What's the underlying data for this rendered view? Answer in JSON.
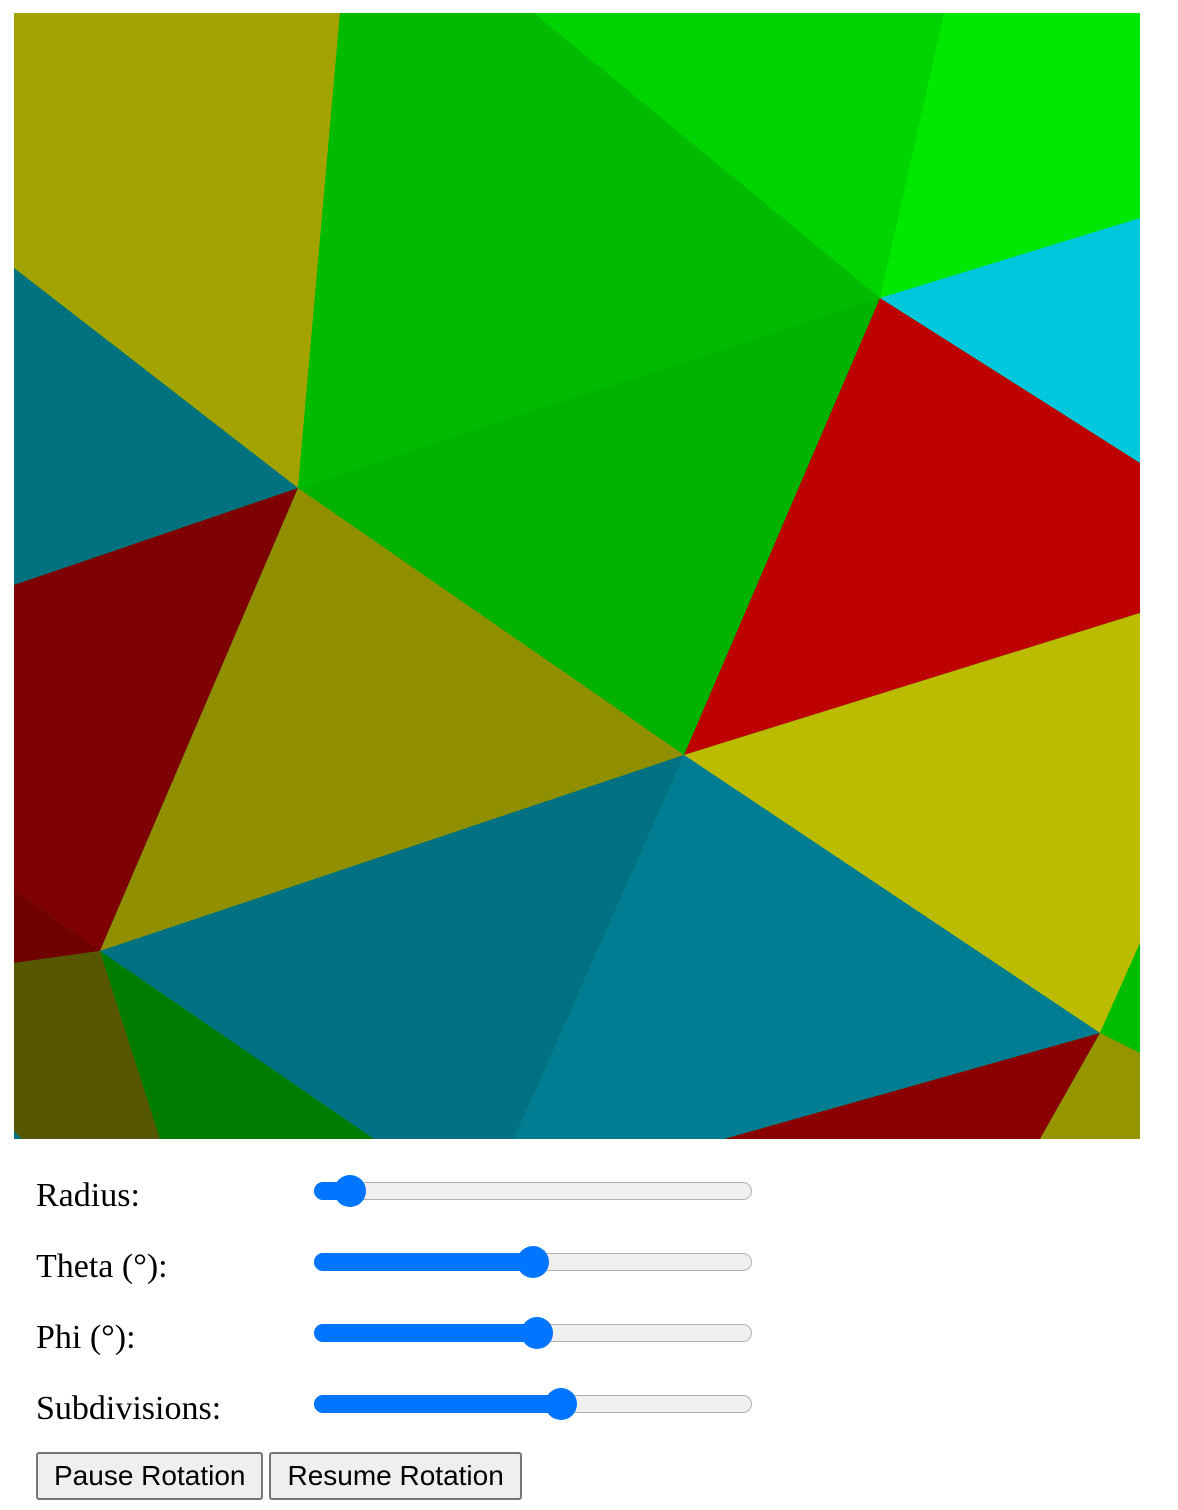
{
  "colors": {
    "accent": "#0075ff",
    "track": "#efefef"
  },
  "controls": {
    "radius": {
      "label": "Radius:",
      "value": 0.05
    },
    "theta": {
      "label": "Theta (°):",
      "value": 0.5
    },
    "phi": {
      "label": "Phi (°):",
      "value": 0.51
    },
    "subdivisions": {
      "label": "Subdivisions:",
      "value": 0.57
    }
  },
  "buttons": {
    "pause_label": "Pause Rotation",
    "resume_label": "Resume Rotation"
  }
}
